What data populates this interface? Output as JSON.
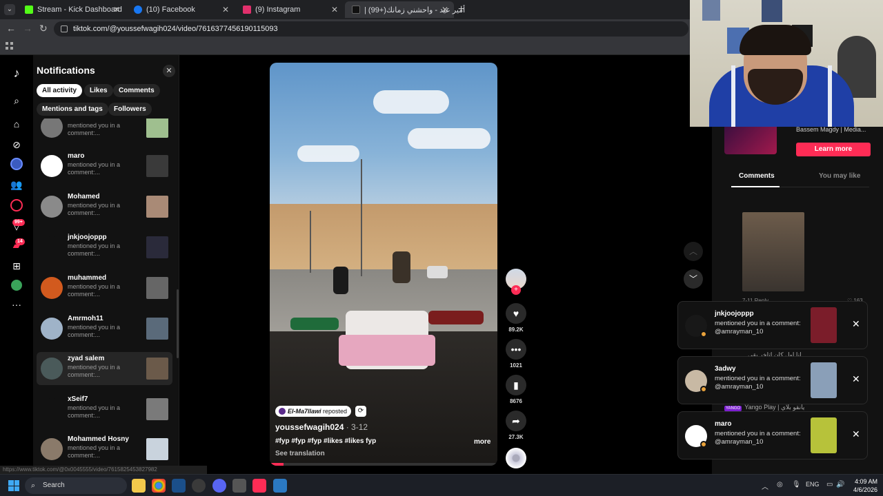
{
  "browser": {
    "tabs": [
      {
        "title": "Stream - Kick Dashboard",
        "favicon_color": "#53fc18"
      },
      {
        "title": "(10) Facebook",
        "favicon_color": "#1877f2"
      },
      {
        "title": "(9) Instagram",
        "favicon_color": "#e1306c"
      },
      {
        "title": "أمير عيد - واحشني زمانك(+99) |",
        "favicon_color": "#111111"
      }
    ],
    "url": "tiktok.com/@youssefwagih024/video/7616377456190115093"
  },
  "sidebar": {
    "badges": {
      "inbox": "99+",
      "messages": "14"
    }
  },
  "notifications": {
    "title": "Notifications",
    "close_glyph": "✕",
    "filters": [
      "All activity",
      "Likes",
      "Comments",
      "Mentions and tags",
      "Followers"
    ],
    "items": [
      {
        "name": "",
        "desc": "mentioned you in a comment:...",
        "avatar": "#777777",
        "thumb": "#9fbf8f"
      },
      {
        "name": "maro",
        "desc": "mentioned you in a comment:...",
        "avatar": "#ffffff",
        "thumb": "#3a3a3a"
      },
      {
        "name": "Mohamed",
        "desc": "mentioned you in a comment:...",
        "avatar": "#8a8a8a",
        "thumb": "#a98a76"
      },
      {
        "name": "jnkjoojoppp",
        "desc": "mentioned you in a comment:...",
        "avatar": "#121212",
        "thumb": "#2a2a3a"
      },
      {
        "name": "muhammed",
        "desc": "mentioned you in a comment:...",
        "avatar": "#d25a1e",
        "thumb": "#666666"
      },
      {
        "name": "Amrmoh11",
        "desc": "mentioned you in a comment:...",
        "avatar": "#9fb3c8",
        "thumb": "#5a6a7a"
      },
      {
        "name": "zyad salem",
        "desc": "mentioned you in a comment:...",
        "avatar": "#4a5a5a",
        "thumb": "#6b5a4a"
      },
      {
        "name": "xSeif7",
        "desc": "mentioned you in a comment:...",
        "avatar": "#121212",
        "thumb": "#7a7a7a"
      },
      {
        "name": "Mohammed Hosny",
        "desc": "mentioned you in a comment:...",
        "avatar": "#8a7a6a",
        "thumb": "#c9d3dd"
      }
    ]
  },
  "video": {
    "reposter": "El-Ma7llawi",
    "reposted_label": "reposted",
    "author": "youssefwagih024",
    "date": "· 3-12",
    "caption": "#fyp #fyp #fyp #likes #likes fyp",
    "more": "more",
    "see_translation": "See translation",
    "progress": 0.06
  },
  "actions": {
    "likes": "89.2K",
    "comments": "1021",
    "saves": "8676",
    "shares": "27.3K"
  },
  "right_panel": {
    "ad_name": "Bassem Magdy | Media...",
    "learn_more": "Learn more",
    "tabs": [
      "Comments",
      "You may like"
    ],
    "comment_time": "7-11  Reply",
    "comment_likes": "♡ 163",
    "arabic_comment": "انا اول كان اتاخر بقى",
    "yango_logo": "YANGO",
    "yango_label": "Yango Play | يانقو بلاي"
  },
  "toasts": [
    {
      "name": "jnkjoojoppp",
      "desc": "mentioned you in a comment: @amrayman_10",
      "avatar": "#181818",
      "thumb": "#7b1d2a"
    },
    {
      "name": "3adwy",
      "desc": "mentioned you in a comment: @amrayman_10",
      "avatar": "#c8b9a4",
      "thumb": "#8a9fb8"
    },
    {
      "name": "maro",
      "desc": "mentioned you in a comment: @amrayman_10",
      "avatar": "#ffffff",
      "thumb": "#b7c23a"
    }
  ],
  "statusbar": "https://www.tiktok.com/@0x0045555/video/7615825453827982",
  "taskbar": {
    "search": "Search",
    "lang": "ENG",
    "time": "4:09 AM",
    "date": "4/6/2026"
  }
}
